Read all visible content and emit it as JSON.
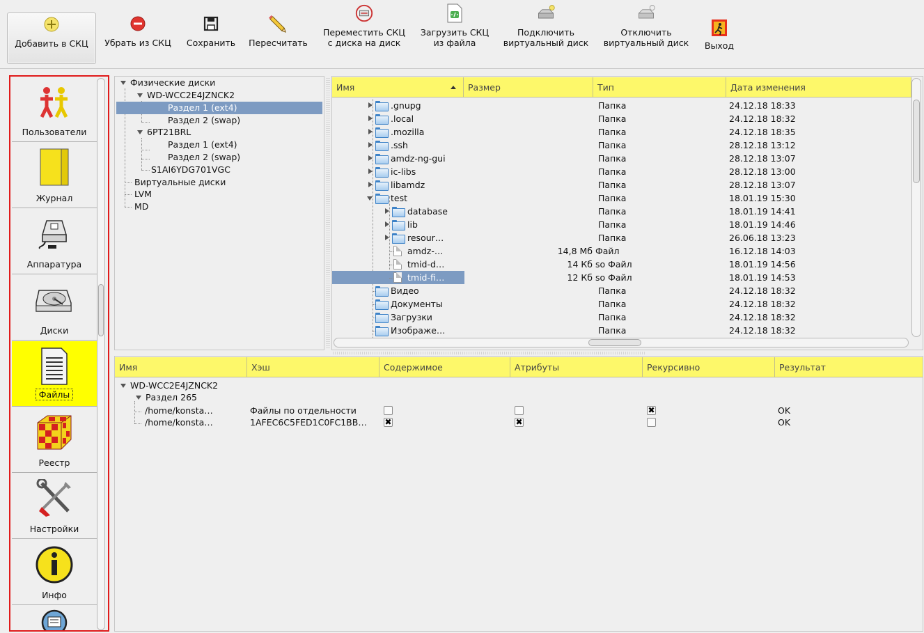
{
  "toolbar": {
    "buttons": [
      {
        "label": "Добавить в СКЦ"
      },
      {
        "label": "Убрать из СКЦ"
      },
      {
        "label": "Сохранить"
      },
      {
        "label": "Пересчитать"
      },
      {
        "label": "Переместить СКЦ\nс диска на диск"
      },
      {
        "label": "Загрузить СКЦ\nиз файла"
      },
      {
        "label": "Подключить\nвиртуальный диск"
      },
      {
        "label": "Отключить\nвиртуальный диск"
      },
      {
        "label": "Выход"
      }
    ]
  },
  "sidebar": {
    "items": [
      {
        "label": "Пользователи",
        "icon": "users-icon"
      },
      {
        "label": "Журнал",
        "icon": "journal-icon"
      },
      {
        "label": "Аппаратура",
        "icon": "hardware-icon"
      },
      {
        "label": "Диски",
        "icon": "disk-icon"
      },
      {
        "label": "Файлы",
        "icon": "files-icon",
        "active": true
      },
      {
        "label": "Реестр",
        "icon": "registry-cube-icon"
      },
      {
        "label": "Настройки",
        "icon": "tools-icon"
      },
      {
        "label": "Инфо",
        "icon": "info-icon"
      }
    ]
  },
  "disk_tree": {
    "nodes": [
      {
        "label": "Физические диски"
      },
      {
        "label": "WD-WCC2E4JZNCK2"
      },
      {
        "label": "Раздел 1 (ext4)",
        "selected": true
      },
      {
        "label": "Раздел 2 (swap)"
      },
      {
        "label": "6PT21BRL"
      },
      {
        "label": "Раздел 1 (ext4)"
      },
      {
        "label": "Раздел 2 (swap)"
      },
      {
        "label": "S1AI6YDG701VGC"
      },
      {
        "label": "Виртуальные диски"
      },
      {
        "label": "LVM"
      },
      {
        "label": "MD"
      }
    ]
  },
  "file_view": {
    "columns": {
      "name": "Имя",
      "size": "Размер",
      "type": "Тип",
      "date": "Дата изменения"
    },
    "rows": [
      {
        "name": ".gnupg",
        "size": "",
        "type": "Папка",
        "date": "24.12.18 18:33"
      },
      {
        "name": ".local",
        "size": "",
        "type": "Папка",
        "date": "24.12.18 18:32"
      },
      {
        "name": ".mozilla",
        "size": "",
        "type": "Папка",
        "date": "24.12.18 18:35"
      },
      {
        "name": ".ssh",
        "size": "",
        "type": "Папка",
        "date": "28.12.18 13:12"
      },
      {
        "name": "amdz-ng-gui",
        "size": "",
        "type": "Папка",
        "date": "28.12.18 13:07"
      },
      {
        "name": "ic-libs",
        "size": "",
        "type": "Папка",
        "date": "28.12.18 13:00"
      },
      {
        "name": "libamdz",
        "size": "",
        "type": "Папка",
        "date": "28.12.18 13:07"
      },
      {
        "name": "test",
        "size": "",
        "type": "Папка",
        "date": "18.01.19 15:30"
      },
      {
        "name": "database",
        "size": "",
        "type": "Папка",
        "date": "18.01.19 14:41"
      },
      {
        "name": "lib",
        "size": "",
        "type": "Папка",
        "date": "18.01.19 14:46"
      },
      {
        "name": "resour…",
        "size": "",
        "type": "Папка",
        "date": "26.06.18 13:23"
      },
      {
        "name": "amdz-…",
        "size": "14,8 Мб",
        "type": "Файл",
        "date": "16.12.18 14:03"
      },
      {
        "name": "tmid-d…",
        "size": "14 Кб",
        "type": "so Файл",
        "date": "18.01.19 14:56"
      },
      {
        "name": "tmid-fi…",
        "size": "12 Кб",
        "type": "so Файл",
        "date": "18.01.19 14:53",
        "selected": true
      },
      {
        "name": "Видео",
        "size": "",
        "type": "Папка",
        "date": "24.12.18 18:32"
      },
      {
        "name": "Документы",
        "size": "",
        "type": "Папка",
        "date": "24.12.18 18:32"
      },
      {
        "name": "Загрузки",
        "size": "",
        "type": "Папка",
        "date": "24.12.18 18:32"
      },
      {
        "name": "Изображе…",
        "size": "",
        "type": "Папка",
        "date": "24.12.18 18:32"
      }
    ]
  },
  "results": {
    "columns": {
      "name": "Имя",
      "hash": "Хэш",
      "content": "Содержимое",
      "attrs": "Атрибуты",
      "recursive": "Рекурсивно",
      "result": "Результат"
    },
    "disk": "WD-WCC2E4JZNCK2",
    "partition": "Раздел 265",
    "rows": [
      {
        "path": "/home/konsta…",
        "hash": "Файлы по отдельности",
        "content": false,
        "attrs": false,
        "recursive": true,
        "result": "OK"
      },
      {
        "path": "/home/konsta…",
        "hash": "1AFEC6C5FED1C0FC1BB…",
        "content": true,
        "attrs": true,
        "recursive": false,
        "result": "OK"
      }
    ]
  }
}
